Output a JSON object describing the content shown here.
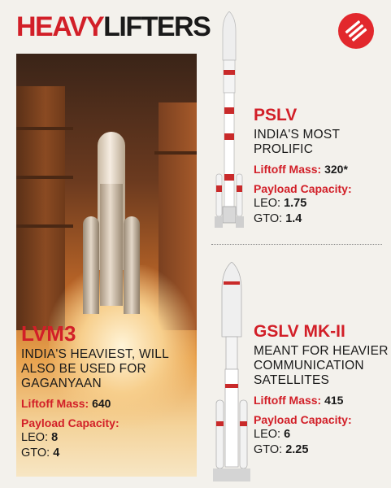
{
  "title": {
    "part1": "HEAVY",
    "part2": "LIFTERS"
  },
  "logo": {
    "icon": "indian-express-logo-icon",
    "color": "#e2282d"
  },
  "accent_color": "#d21f28",
  "lvm3": {
    "name": "LVM3",
    "description": "INDIA'S HEAVIEST, WILL ALSO BE USED FOR GAGANYAAN",
    "liftoff_label": "Liftoff Mass:",
    "liftoff_value": "640",
    "payload_label": "Payload Capacity:",
    "leo_label": "LEO:",
    "leo_value": "8",
    "gto_label": "GTO:",
    "gto_value": "4"
  },
  "pslv": {
    "name": "PSLV",
    "description": "INDIA'S MOST PROLIFIC",
    "liftoff_label": "Liftoff Mass:",
    "liftoff_value": "320*",
    "payload_label": "Payload Capacity:",
    "leo_label": "LEO:",
    "leo_value": "1.75",
    "gto_label": "GTO:",
    "gto_value": "1.4"
  },
  "gslv": {
    "name": "GSLV MK-II",
    "description": "MEANT FOR HEAVIER COMMUNICATION SATELLITES",
    "liftoff_label": "Liftoff Mass:",
    "liftoff_value": "415",
    "payload_label": "Payload Capacity:",
    "leo_label": "LEO:",
    "leo_value": "6",
    "gto_label": "GTO:",
    "gto_value": "2.25"
  }
}
